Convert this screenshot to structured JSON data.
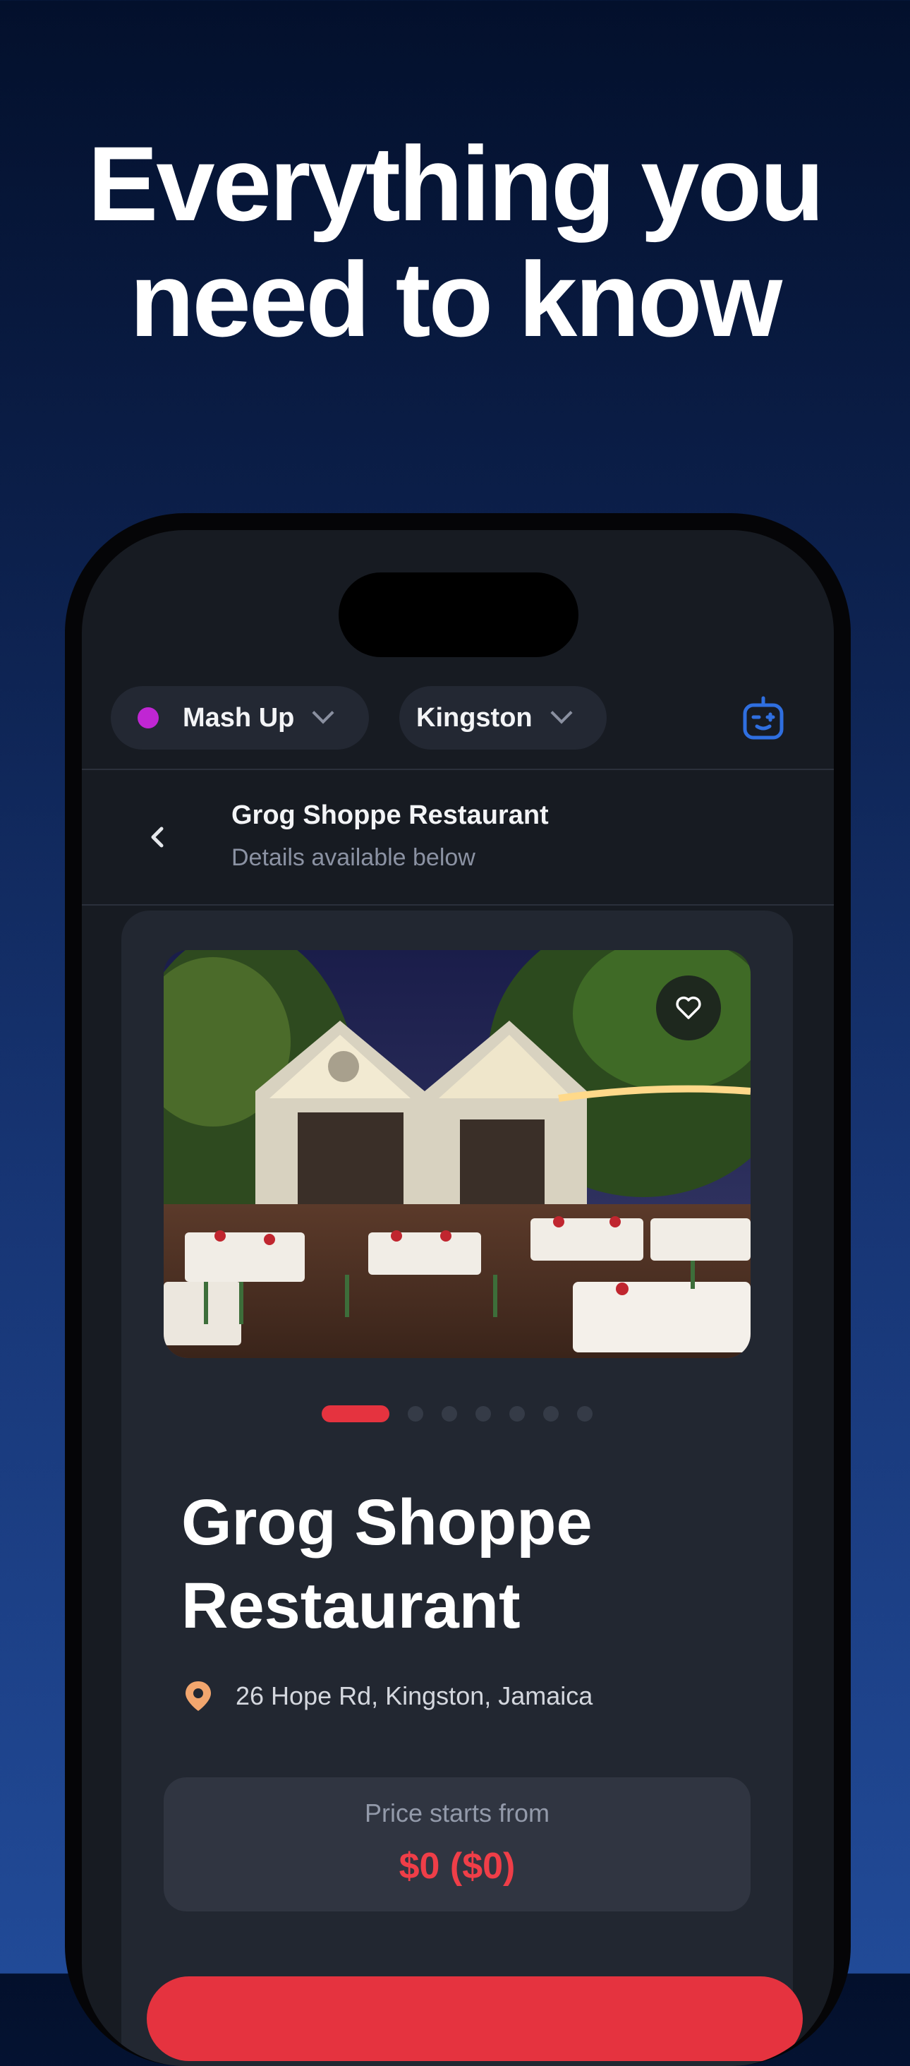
{
  "headline": {
    "line1": "Everything you",
    "line2": "need to know"
  },
  "filters": {
    "category": {
      "label": "Mash Up",
      "dot_color": "#c026d3",
      "icon": "chevron-down-icon"
    },
    "location": {
      "label": "Kingston",
      "icon": "chevron-down-icon"
    },
    "assistant_icon": "robot-icon",
    "accent": "#2f6fe0"
  },
  "nav": {
    "back_icon": "chevron-left-icon",
    "title": "Grog Shoppe Restaurant",
    "subtitle": "Details available below"
  },
  "place": {
    "photo": "restaurant-courtyard-photo",
    "favorite_icon": "heart-icon",
    "carousel": {
      "total": 7,
      "active_index": 0
    },
    "name": "Grog Shoppe Restaurant",
    "address_icon": "map-pin-icon",
    "address": "26 Hope Rd, Kingston, Jamaica",
    "price": {
      "label": "Price starts from",
      "value": "$0 ($0)"
    }
  },
  "colors": {
    "primary": "#e5333f",
    "background": "#171b22",
    "card": "#222731"
  }
}
